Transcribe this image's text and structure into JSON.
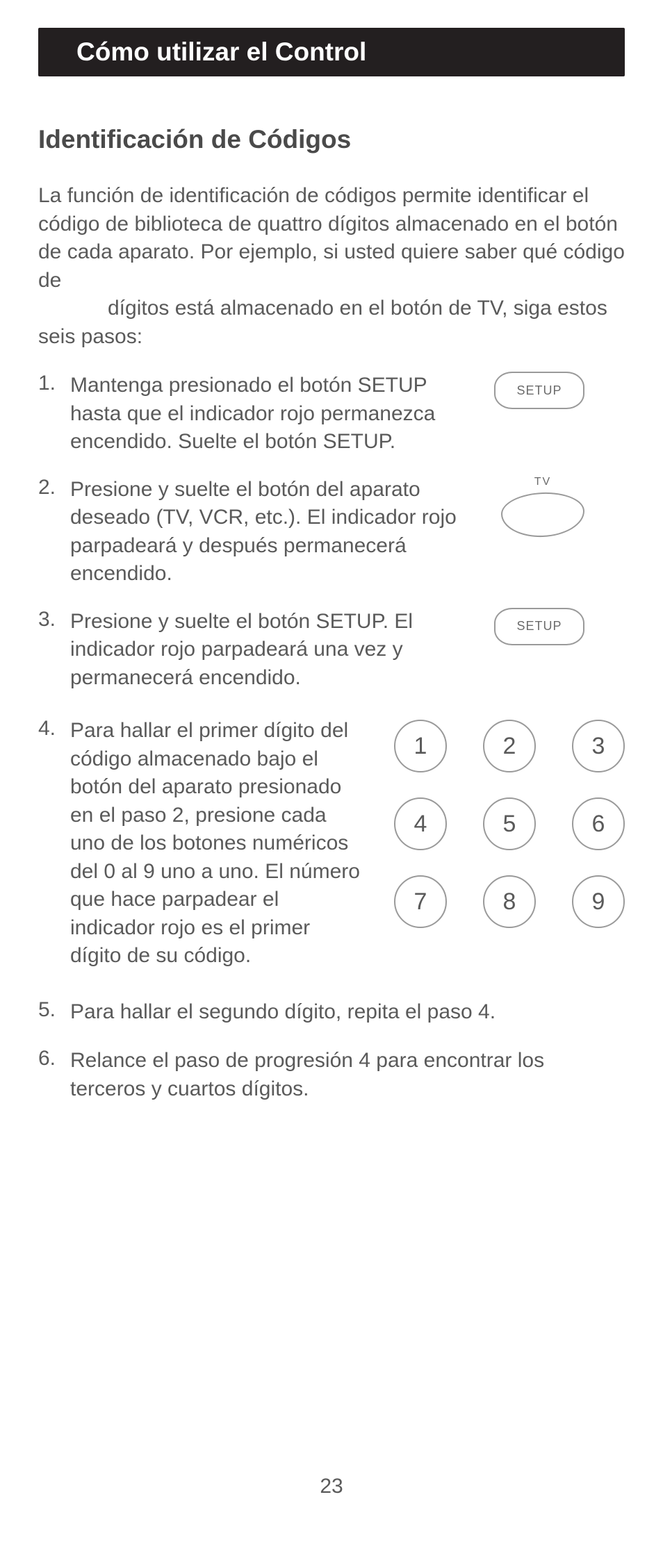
{
  "header": "Cómo utilizar el Control",
  "subheading": "Identificación de Códigos",
  "intro_part1": "La función de identificación de códigos permite identificar el código de biblioteca de quattro dígitos almacenado en el botón de cada aparato. Por ejemplo, si usted quiere saber qué código de",
  "intro_part2": "dígitos está almacenado en el botón de TV, siga estos seis pasos:",
  "steps": {
    "s1": {
      "num": "1.",
      "text": "Mantenga presionado el botón SETUP hasta que el indicador rojo permanezca encendido. Suelte el botón SETUP."
    },
    "s2": {
      "num": "2.",
      "text": "Presione y suelte el botón del aparato deseado (TV, VCR, etc.). El indicador rojo parpadeará y después permanecerá encendido."
    },
    "s3": {
      "num": "3.",
      "text": "Presione y suelte el botón SETUP. El indicador rojo parpadeará una vez y permanecerá encendido."
    },
    "s4": {
      "num": "4.",
      "text": "Para hallar el primer dígito del código almacenado bajo el botón del aparato presionado en el paso 2, presione cada uno de los botones numéricos del 0 al 9 uno a uno. El número que hace parpadear el indicador rojo es el primer dígito de su código."
    },
    "s5": {
      "num": "5.",
      "text": "Para hallar el segundo dígito, repita el paso 4."
    },
    "s6": {
      "num": "6.",
      "text": "Relance el paso de progresión 4 para encontrar los terceros y cuartos dígitos."
    }
  },
  "buttons": {
    "setup_label": "SETUP",
    "tv_label": "TV"
  },
  "keypad": {
    "k1": "1",
    "k2": "2",
    "k3": "3",
    "k4": "4",
    "k5": "5",
    "k6": "6",
    "k7": "7",
    "k8": "8",
    "k9": "9"
  },
  "page_number": "23"
}
